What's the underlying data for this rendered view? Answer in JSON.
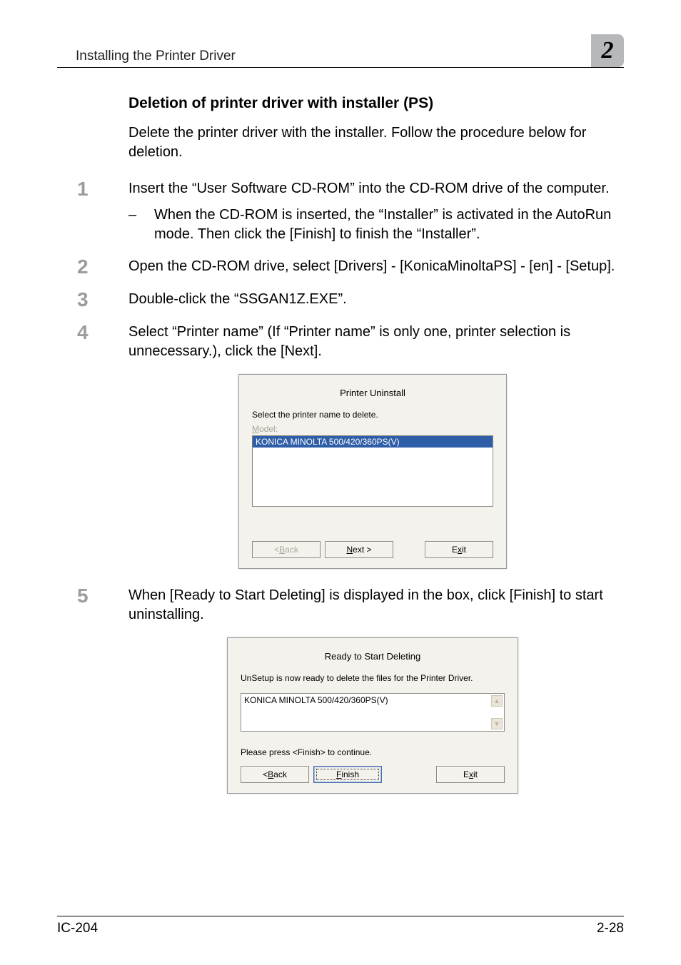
{
  "header": {
    "section": "Installing the Printer Driver",
    "chapter": "2"
  },
  "section_title": "Deletion of printer driver with installer (PS)",
  "intro": "Delete the printer driver with the installer. Follow the procedure below for deletion.",
  "steps": {
    "s1": {
      "num": "1",
      "text": "Insert the “User Software CD-ROM” into the CD-ROM drive of the computer.",
      "bullet_dash": "–",
      "bullet_text": "When the CD-ROM is inserted, the “Installer” is activated in the AutoRun mode. Then click the [Finish] to finish the “Installer”."
    },
    "s2": {
      "num": "2",
      "text": "Open the CD-ROM drive, select [Drivers] - [KonicaMinoltaPS] - [en] - [Setup]."
    },
    "s3": {
      "num": "3",
      "text": "Double-click the “SSGAN1Z.EXE”."
    },
    "s4": {
      "num": "4",
      "text": "Select “Printer name” (If “Printer name” is only one, printer selection is unnecessary.), click the [Next]."
    },
    "s5": {
      "num": "5",
      "text": "When [Ready to Start Deleting] is displayed in the box, click [Finish] to start uninstalling."
    }
  },
  "dialog1": {
    "title": "Printer Uninstall",
    "instruction": "Select the printer name to delete.",
    "model_label": "Model:",
    "selected_item": "KONICA MINOLTA 500/420/360PS(V)",
    "back": "< Back",
    "next": "Next >",
    "exit": "Exit"
  },
  "dialog2": {
    "title": "Ready to Start Deleting",
    "instruction": "UnSetup is now ready to delete the files for the Printer Driver.",
    "item": "KONICA MINOLTA 500/420/360PS(V)",
    "continue_text": "Please press <Finish> to continue.",
    "back": "< Back",
    "finish": "Finish",
    "exit": "Exit"
  },
  "footer": {
    "left": "IC-204",
    "right": "2-28"
  }
}
